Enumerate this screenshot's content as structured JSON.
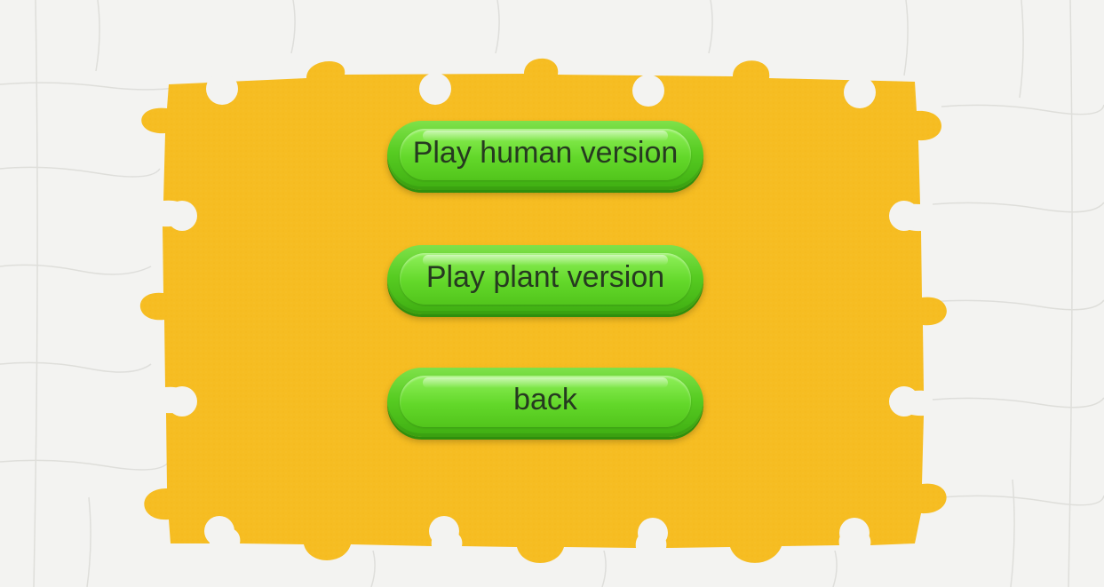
{
  "menu": {
    "buttons": [
      {
        "label": "Play human version"
      },
      {
        "label": "Play plant version"
      },
      {
        "label": "back"
      }
    ]
  },
  "colors": {
    "board": "#f6bd22",
    "puzzle_frame": "#f3f3f1",
    "button_green": "#57cc22",
    "button_text": "#263a20"
  }
}
